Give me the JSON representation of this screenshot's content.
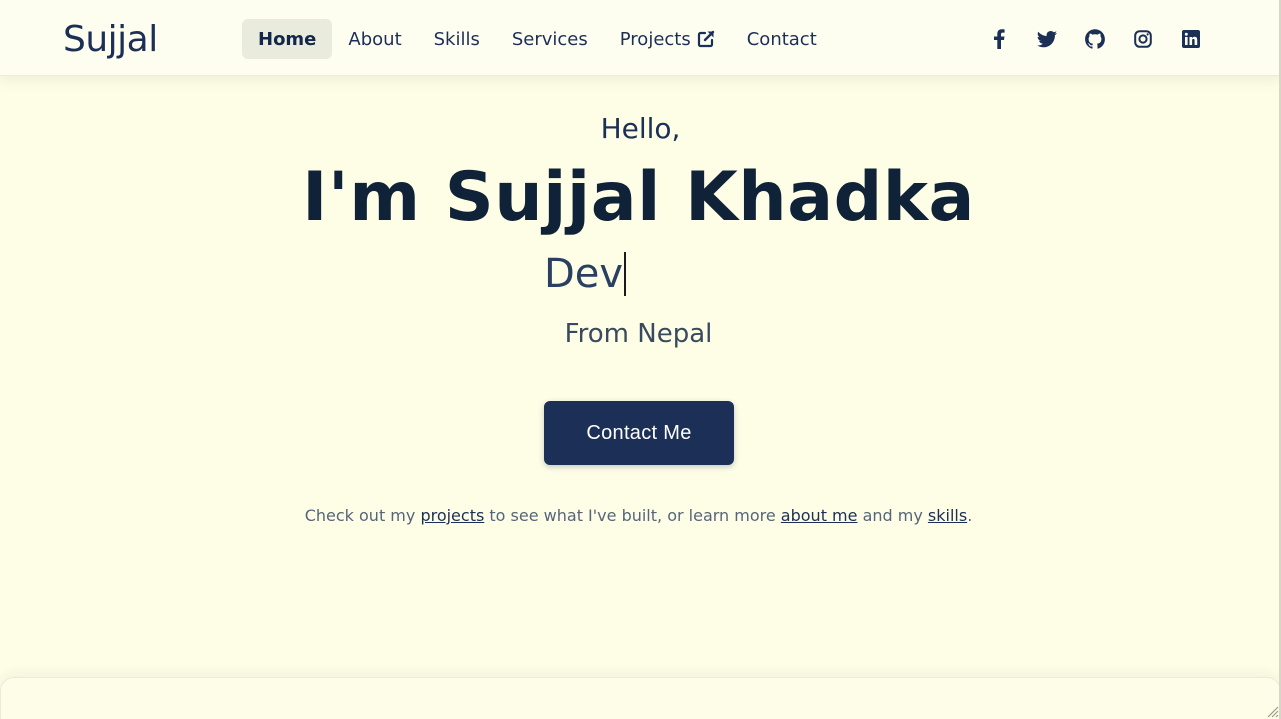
{
  "brand": {
    "logo_text": "Sujjal"
  },
  "nav": {
    "items": [
      {
        "label": "Home",
        "active": true
      },
      {
        "label": "About",
        "active": false
      },
      {
        "label": "Skills",
        "active": false
      },
      {
        "label": "Services",
        "active": false
      },
      {
        "label": "Projects",
        "active": false,
        "icon": "external-link-icon"
      },
      {
        "label": "Contact",
        "active": false
      }
    ]
  },
  "socials": [
    {
      "name": "facebook-icon"
    },
    {
      "name": "twitter-icon"
    },
    {
      "name": "github-icon"
    },
    {
      "name": "instagram-icon"
    },
    {
      "name": "linkedin-icon"
    }
  ],
  "hero": {
    "greeting": "Hello,",
    "name": "I'm Sujjal Khadka",
    "typed_text": "Dev",
    "location": "From Nepal",
    "cta_label": "Contact Me",
    "note": {
      "prefix": "Check out my ",
      "link_projects": "projects",
      "mid1": " to see what I've built, or learn more ",
      "link_about": "about me",
      "mid2": " and my ",
      "link_skills": "skills",
      "suffix": "."
    }
  },
  "colors": {
    "background": "#fefee6",
    "navy": "#1c2f56",
    "heading": "#0f2237",
    "muted": "#56657a"
  }
}
